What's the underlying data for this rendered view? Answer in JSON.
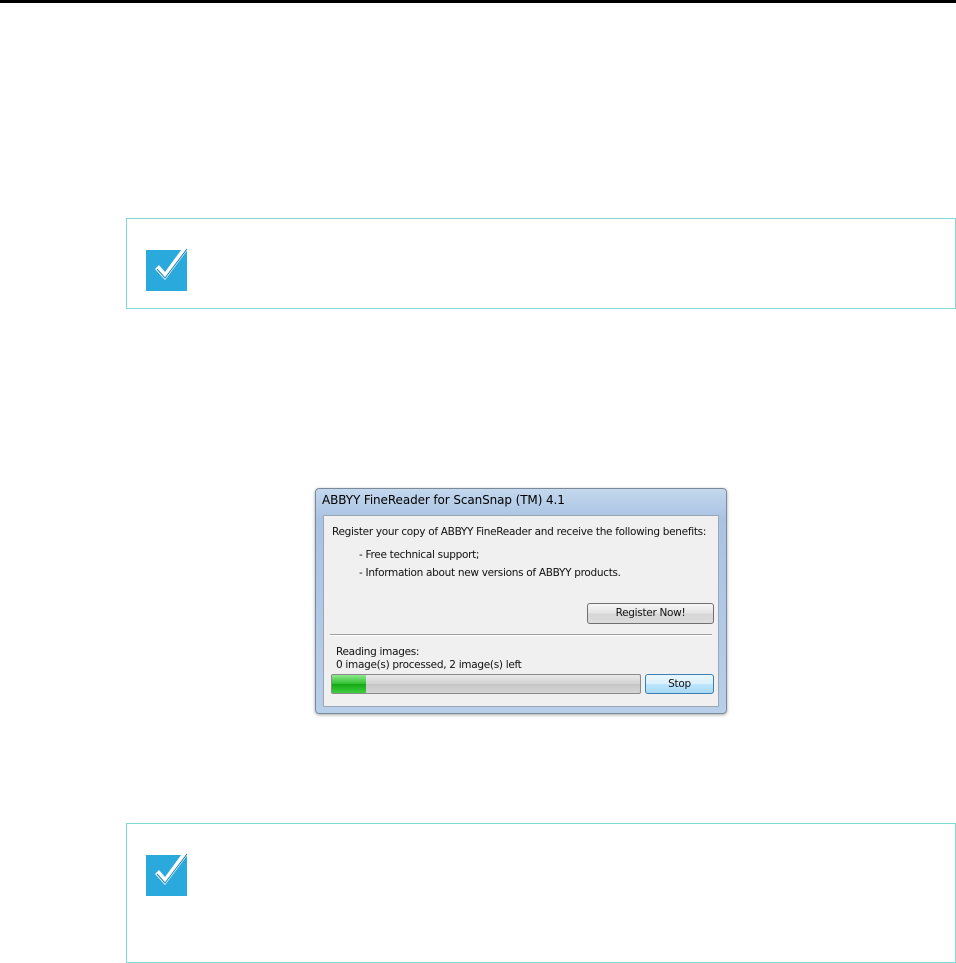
{
  "dialog": {
    "title": "ABBYY FineReader for ScanSnap (TM) 4.1",
    "intro": "Register your copy of ABBYY FineReader and receive the following benefits:",
    "benefits": [
      "- Free technical support;",
      "- Information about new versions of ABBYY products."
    ],
    "register_label": "Register Now!",
    "status_line1": "Reading  images:",
    "status_line2": "0 image(s) processed, 2 image(s) left",
    "progress_fraction": 0.11,
    "stop_label": "Stop"
  },
  "colors": {
    "hint_border": "#7fd9d4",
    "check_icon": "#2aa9dc",
    "progress_fill": "#2ec02e"
  },
  "icons": {
    "hint": "checkmark-icon"
  }
}
